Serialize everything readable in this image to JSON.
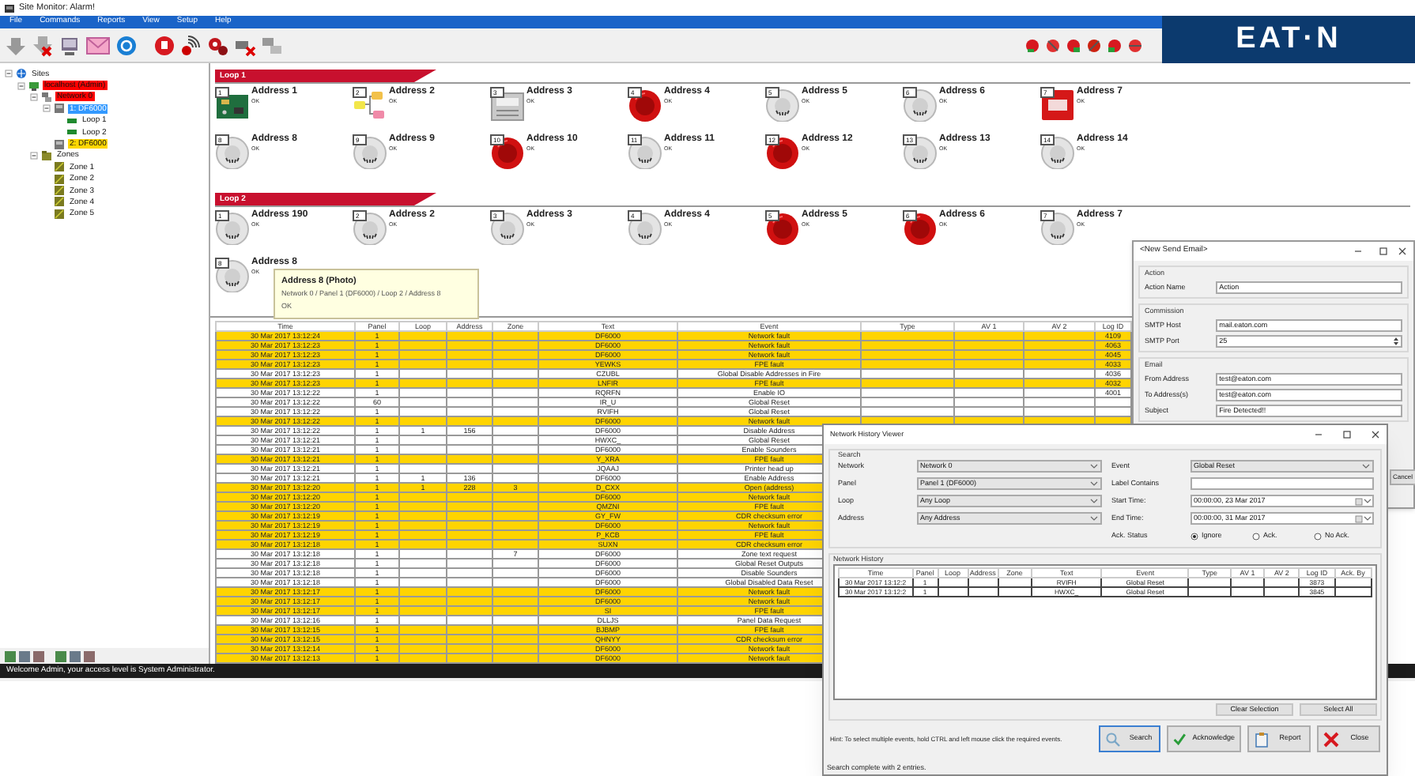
{
  "window": {
    "title": "Site Monitor: Alarm!"
  },
  "menu": [
    "File",
    "Commands",
    "Reports",
    "View",
    "Setup",
    "Help"
  ],
  "logo": "EAT·N",
  "tree": [
    {
      "label": "Sites",
      "kind": "sites",
      "selected": false,
      "expanded": true,
      "children": [
        {
          "label": "localhost (Admin)",
          "kind": "server",
          "selected": false,
          "color": "#ff0000",
          "expanded": true,
          "children": [
            {
              "label": "Network 0",
              "kind": "network",
              "selected": false,
              "color": "#ff0000",
              "expanded": true,
              "children": [
                {
                  "label": "1: DF6000",
                  "kind": "panel",
                  "selected": true,
                  "expanded": true,
                  "children": [
                    {
                      "label": "Loop 1",
                      "kind": "loop",
                      "selected": false
                    },
                    {
                      "label": "Loop 2",
                      "kind": "loop",
                      "selected": false
                    }
                  ]
                },
                {
                  "label": "2: DF6000",
                  "kind": "panel",
                  "selected": false,
                  "color": "#ffd700"
                }
              ]
            },
            {
              "label": "Zones",
              "kind": "zones",
              "selected": false,
              "expanded": true,
              "children": [
                {
                  "label": "Zone 1",
                  "kind": "zone",
                  "selected": false
                },
                {
                  "label": "Zone 2",
                  "kind": "zone",
                  "selected": false
                },
                {
                  "label": "Zone 3",
                  "kind": "zone",
                  "selected": false
                },
                {
                  "label": "Zone 4",
                  "kind": "zone",
                  "selected": false
                },
                {
                  "label": "Zone 5",
                  "kind": "zone",
                  "selected": false
                }
              ]
            }
          ]
        }
      ]
    }
  ],
  "loops": [
    {
      "title": "Loop 1",
      "devices": [
        {
          "number": "1",
          "name": "Address 1",
          "status": "OK",
          "kind": "board"
        },
        {
          "number": "2",
          "name": "Address 2",
          "status": "OK",
          "kind": "network"
        },
        {
          "number": "3",
          "name": "Address 3",
          "status": "OK",
          "kind": "panel"
        },
        {
          "number": "4",
          "name": "Address 4",
          "status": "OK",
          "kind": "sounder"
        },
        {
          "number": "5",
          "name": "Address 5",
          "status": "OK",
          "kind": "detector"
        },
        {
          "number": "6",
          "name": "Address 6",
          "status": "OK",
          "kind": "detector"
        },
        {
          "number": "7",
          "name": "Address 7",
          "status": "OK",
          "kind": "callpoint"
        },
        {
          "number": "8",
          "name": "Address 8",
          "status": "OK",
          "kind": "detector"
        },
        {
          "number": "9",
          "name": "Address 9",
          "status": "OK",
          "kind": "detector"
        },
        {
          "number": "10",
          "name": "Address 10",
          "status": "OK",
          "kind": "sounder"
        },
        {
          "number": "11",
          "name": "Address 11",
          "status": "OK",
          "kind": "detector"
        },
        {
          "number": "12",
          "name": "Address 12",
          "status": "OK",
          "kind": "sounder"
        },
        {
          "number": "13",
          "name": "Address 13",
          "status": "OK",
          "kind": "detector"
        },
        {
          "number": "14",
          "name": "Address 14",
          "status": "OK",
          "kind": "detector"
        }
      ]
    },
    {
      "title": "Loop 2",
      "devices": [
        {
          "number": "1",
          "name": "Address 190",
          "status": "OK",
          "kind": "detector"
        },
        {
          "number": "2",
          "name": "Address 2",
          "status": "OK",
          "kind": "detector"
        },
        {
          "number": "3",
          "name": "Address 3",
          "status": "OK",
          "kind": "detector"
        },
        {
          "number": "4",
          "name": "Address 4",
          "status": "OK",
          "kind": "detector"
        },
        {
          "number": "5",
          "name": "Address 5",
          "status": "OK",
          "kind": "sounder"
        },
        {
          "number": "6",
          "name": "Address 6",
          "status": "OK",
          "kind": "sounder"
        },
        {
          "number": "7",
          "name": "Address 7",
          "status": "OK",
          "kind": "detector"
        },
        {
          "number": "8",
          "name": "Address 8",
          "status": "OK",
          "kind": "detector"
        }
      ]
    }
  ],
  "tooltip": {
    "title": "Address 8 (Photo)",
    "path": "Network 0 / Panel 1 (DF6000) / Loop 2 / Address 8",
    "status": "OK"
  },
  "events": {
    "columns": [
      "Time",
      "Panel",
      "Loop",
      "Address",
      "Zone",
      "Text",
      "Event",
      "Type",
      "AV 1",
      "AV 2",
      "Log ID"
    ],
    "rows": [
      {
        "time": "30 Mar 2017 13:12:24",
        "panel": "1",
        "text": "DF6000",
        "event": "Network fault",
        "log_id": "4109",
        "highlighted": true
      },
      {
        "time": "30 Mar 2017 13:12:23",
        "panel": "1",
        "text": "DF6000",
        "event": "Network fault",
        "log_id": "4063",
        "highlighted": true
      },
      {
        "time": "30 Mar 2017 13:12:23",
        "panel": "1",
        "text": "DF6000",
        "event": "Network fault",
        "log_id": "4045",
        "highlighted": true
      },
      {
        "time": "30 Mar 2017 13:12:23",
        "panel": "1",
        "text": "YEWKS",
        "event": "FPE fault",
        "log_id": "4033",
        "highlighted": true
      },
      {
        "time": "30 Mar 2017 13:12:23",
        "panel": "1",
        "text": "CZUBL",
        "event": "Global Disable Addresses in Fire",
        "log_id": "4036",
        "highlighted": false
      },
      {
        "time": "30 Mar 2017 13:12:23",
        "panel": "1",
        "text": "LNFIR",
        "event": "FPE fault",
        "log_id": "4032",
        "highlighted": true
      },
      {
        "time": "30 Mar 2017 13:12:22",
        "panel": "1",
        "text": "RQRFN",
        "event": "Enable IO",
        "log_id": "4001",
        "highlighted": false
      },
      {
        "time": "30 Mar 2017 13:12:22",
        "panel": "60",
        "text": "IR_U",
        "event": "Global Reset",
        "highlighted": false
      },
      {
        "time": "30 Mar 2017 13:12:22",
        "panel": "1",
        "text": "RVIFH",
        "event": "Global Reset",
        "highlighted": false
      },
      {
        "time": "30 Mar 2017 13:12:22",
        "panel": "1",
        "text": "DF6000",
        "event": "Network fault",
        "highlighted": true
      },
      {
        "time": "30 Mar 2017 13:12:22",
        "panel": "1",
        "loop": "1",
        "address": "156",
        "text": "DF6000",
        "event": "Disable Address",
        "highlighted": false
      },
      {
        "time": "30 Mar 2017 13:12:21",
        "panel": "1",
        "text": "HWXC_",
        "event": "Global Reset",
        "highlighted": false
      },
      {
        "time": "30 Mar 2017 13:12:21",
        "panel": "1",
        "text": "DF6000",
        "event": "Enable Sounders",
        "highlighted": false
      },
      {
        "time": "30 Mar 2017 13:12:21",
        "panel": "1",
        "text": "Y_XRA",
        "event": "FPE fault",
        "highlighted": true
      },
      {
        "time": "30 Mar 2017 13:12:21",
        "panel": "1",
        "text": "JQAAJ",
        "event": "Printer head up",
        "highlighted": false
      },
      {
        "time": "30 Mar 2017 13:12:21",
        "panel": "1",
        "loop": "1",
        "address": "136",
        "text": "DF6000",
        "event": "Enable Address",
        "highlighted": false
      },
      {
        "time": "30 Mar 2017 13:12:20",
        "panel": "1",
        "loop": "1",
        "address": "228",
        "zone": "3",
        "text": "D_CXX",
        "event": "Open (address)",
        "highlighted": true
      },
      {
        "time": "30 Mar 2017 13:12:20",
        "panel": "1",
        "text": "DF6000",
        "event": "Network fault",
        "highlighted": true
      },
      {
        "time": "30 Mar 2017 13:12:20",
        "panel": "1",
        "text": "QMZNI",
        "event": "FPE fault",
        "highlighted": true
      },
      {
        "time": "30 Mar 2017 13:12:19",
        "panel": "1",
        "text": "GY_FW",
        "event": "CDR checksum error",
        "highlighted": true
      },
      {
        "time": "30 Mar 2017 13:12:19",
        "panel": "1",
        "text": "DF6000",
        "event": "Network fault",
        "highlighted": true
      },
      {
        "time": "30 Mar 2017 13:12:19",
        "panel": "1",
        "text": "P_KCB",
        "event": "FPE fault",
        "highlighted": true
      },
      {
        "time": "30 Mar 2017 13:12:18",
        "panel": "1",
        "text": "SUXN",
        "event": "CDR checksum error",
        "highlighted": true
      },
      {
        "time": "30 Mar 2017 13:12:18",
        "panel": "1",
        "zone": "7",
        "text": "DF6000",
        "event": "Zone text request",
        "highlighted": false
      },
      {
        "time": "30 Mar 2017 13:12:18",
        "panel": "1",
        "text": "DF6000",
        "event": "Global Reset Outputs",
        "highlighted": false
      },
      {
        "time": "30 Mar 2017 13:12:18",
        "panel": "1",
        "text": "DF6000",
        "event": "Disable Sounders",
        "highlighted": false
      },
      {
        "time": "30 Mar 2017 13:12:18",
        "panel": "1",
        "text": "DF6000",
        "event": "Global Disabled Data Reset",
        "highlighted": false
      },
      {
        "time": "30 Mar 2017 13:12:17",
        "panel": "1",
        "text": "DF6000",
        "event": "Network fault",
        "highlighted": true
      },
      {
        "time": "30 Mar 2017 13:12:17",
        "panel": "1",
        "text": "DF6000",
        "event": "Network fault",
        "highlighted": true
      },
      {
        "time": "30 Mar 2017 13:12:17",
        "panel": "1",
        "text": "SI",
        "event": "FPE fault",
        "highlighted": true
      },
      {
        "time": "30 Mar 2017 13:12:16",
        "panel": "1",
        "text": "DLLJS",
        "event": "Panel Data Request",
        "highlighted": false
      },
      {
        "time": "30 Mar 2017 13:12:15",
        "panel": "1",
        "text": "BJBMP",
        "event": "FPE fault",
        "highlighted": true
      },
      {
        "time": "30 Mar 2017 13:12:15",
        "panel": "1",
        "text": "QHNYY",
        "event": "CDR checksum error",
        "highlighted": true
      },
      {
        "time": "30 Mar 2017 13:12:14",
        "panel": "1",
        "text": "DF6000",
        "event": "Network fault",
        "highlighted": true
      },
      {
        "time": "30 Mar 2017 13:12:13",
        "panel": "1",
        "text": "DF6000",
        "event": "Network fault",
        "highlighted": true
      }
    ]
  },
  "status_bar": "Welcome Admin, your access level is System Administrator.",
  "email_dialog": {
    "title": "<New Send Email>",
    "sections": [
      {
        "title": "Action",
        "fields": [
          {
            "label": "Action Name",
            "value": "Action"
          }
        ]
      },
      {
        "title": "Commission",
        "fields": [
          {
            "label": "SMTP Host",
            "value": "mail.eaton.com"
          },
          {
            "label": "SMTP Port",
            "value": "25",
            "kind": "spinner"
          }
        ]
      },
      {
        "title": "Email",
        "fields": [
          {
            "label": "From Address",
            "value": "test@eaton.com"
          },
          {
            "label": "To Address(s)",
            "value": "test@eaton.com"
          },
          {
            "label": "Subject",
            "value": "Fire Detected!!"
          }
        ]
      }
    ],
    "cancel_button": "Cancel"
  },
  "history_viewer": {
    "title": "Network History Viewer",
    "search": {
      "title": "Search",
      "left_fields": [
        {
          "label": "Network",
          "value": "Network 0",
          "kind": "dropdown"
        },
        {
          "label": "Panel",
          "value": "Panel 1 (DF6000)",
          "kind": "dropdown"
        },
        {
          "label": "Loop",
          "value": "Any Loop",
          "kind": "dropdown"
        },
        {
          "label": "Address",
          "value": "Any Address",
          "kind": "dropdown"
        }
      ],
      "right_fields": [
        {
          "label": "Event",
          "value": "Global Reset",
          "kind": "dropdown"
        },
        {
          "label": "Label Contains",
          "kind": "text"
        },
        {
          "label": "Start Time:",
          "value": "00:00:00, 23 Mar 2017",
          "kind": "date"
        },
        {
          "label": "End Time:",
          "value": "00:00:00, 31 Mar 2017",
          "kind": "date"
        }
      ],
      "ack_status": {
        "label": "Ack. Status",
        "options": [
          {
            "label": "Ignore",
            "selected": true
          },
          {
            "label": "Ack.",
            "selected": false
          },
          {
            "label": "No Ack.",
            "selected": false
          }
        ]
      }
    },
    "history": {
      "title": "Network History",
      "columns": [
        "Time",
        "Panel",
        "Loop",
        "Address",
        "Zone",
        "Text",
        "Event",
        "Type",
        "AV 1",
        "AV 2",
        "Log ID",
        "Ack. By"
      ],
      "rows": [
        {
          "time": "30 Mar 2017 13:12:2",
          "panel": "1",
          "text": "RVIFH",
          "event": "Global Reset",
          "log_id": "3873"
        },
        {
          "time": "30 Mar 2017 13:12:2",
          "panel": "1",
          "text": "HWXC_",
          "event": "Global Reset",
          "log_id": "3845"
        }
      ]
    },
    "selection_buttons": [
      "Clear Selection",
      "Select All"
    ],
    "hint": "Hint: To select multiple events, hold CTRL and left mouse click the required events.",
    "buttons": [
      {
        "label": "Search",
        "kind": "search"
      },
      {
        "label": "Acknowledge",
        "kind": "acknowledge"
      },
      {
        "label": "Report",
        "kind": "report"
      },
      {
        "label": "Close",
        "kind": "close"
      }
    ],
    "status": "Search complete with 2 entries."
  }
}
